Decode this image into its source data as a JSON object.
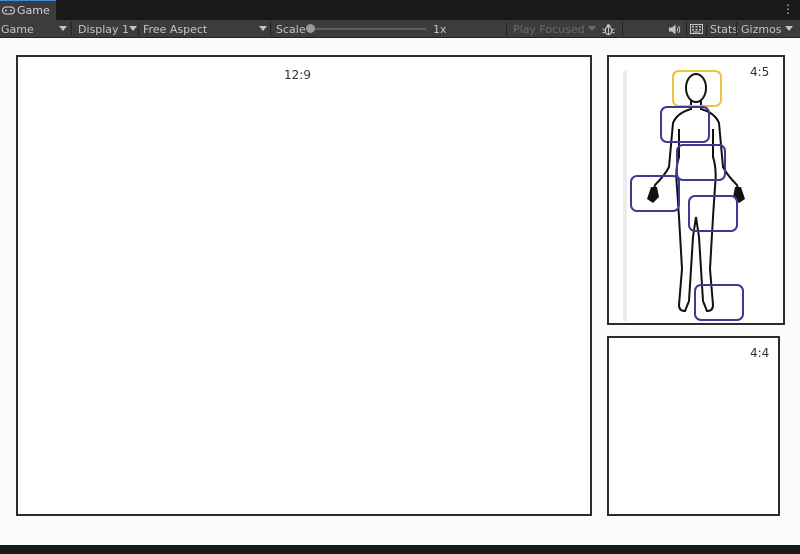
{
  "tab": {
    "title": "Game"
  },
  "toolbar": {
    "mode": "Game",
    "display": "Display 1",
    "aspect": "Free Aspect",
    "scale_label": "Scale",
    "scale_value": "1x",
    "play_mode": "Play Focused",
    "stats_label": "Stats",
    "gizmos_label": "Gizmos"
  },
  "views": {
    "main_label": "12:9",
    "side_top_label": "4:5",
    "side_bottom_label": "4:4"
  },
  "highlights": {
    "selected_color": "#e8c53c",
    "region_color": "#3b3b8f"
  },
  "icons": {
    "tab": "gamepad-icon",
    "debug": "bug-icon",
    "audio": "speaker-icon",
    "keyboard": "keyboard-icon",
    "menu": "kebab-menu-icon"
  }
}
